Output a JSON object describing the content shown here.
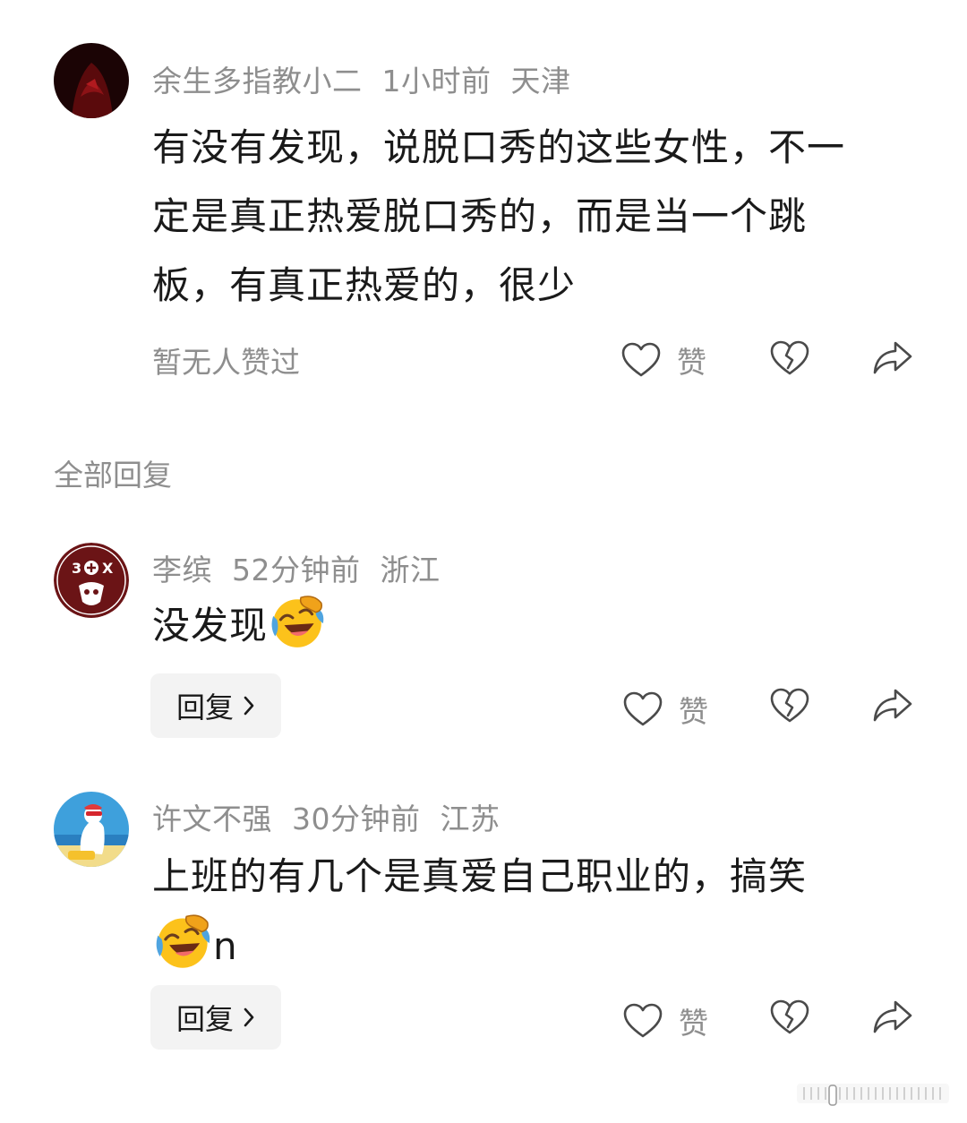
{
  "main_comment": {
    "username": "余生多指教小二",
    "time": "1小时前",
    "location": "天津",
    "text_lines": [
      "有没有发现，说脱口秀的这些女性，不一",
      "定是真正热爱脱口秀的，而是当一个跳",
      "板，有真正热爱的，很少"
    ],
    "likes_text": "暂无人赞过",
    "like_label": "赞"
  },
  "replies_section": {
    "title": "全部回复"
  },
  "replies": [
    {
      "username": "李缤",
      "time": "52分钟前",
      "location": "浙江",
      "text": "没发现",
      "reply_label": "回复",
      "like_label": "赞"
    },
    {
      "username": "许文不强",
      "time": "30分钟前",
      "location": "江苏",
      "text_line1": "上班的有几个是真爱自己职业的，搞笑",
      "text_line2_suffix": "n",
      "reply_label": "回复",
      "like_label": "赞"
    }
  ],
  "icons": {
    "like": "heart-outline-icon",
    "dislike": "broken-heart-icon",
    "share": "share-arrow-icon",
    "emoji": "rolling-laughing-emoji"
  },
  "colors": {
    "meta_gray": "#8e8e8e",
    "text": "#1a1a1a",
    "reply_button_bg": "#f3f3f3"
  }
}
